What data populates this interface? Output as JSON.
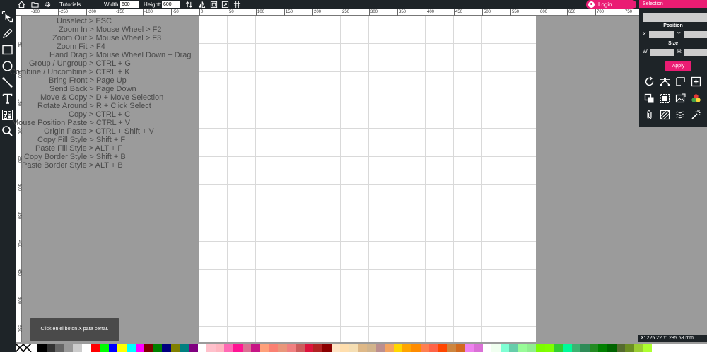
{
  "topbar": {
    "tutorials_label": "Tutorials",
    "width_label": "Width:",
    "width_value": "600",
    "height_label": "Height:",
    "height_value": "600",
    "login_label": "Login",
    "icons": [
      "home-icon",
      "open-folder-icon",
      "settings-icon",
      "swap-vertical-icon",
      "flip-icon",
      "fit-icon",
      "resize-icon",
      "grid-icon"
    ]
  },
  "tools": [
    "select-icon",
    "pencil-icon",
    "rectangle-icon",
    "ellipse-icon",
    "line-icon",
    "text-icon",
    "shapes-icon",
    "zoom-icon"
  ],
  "ruler": {
    "h_ticks": [
      "-300",
      "-250",
      "-200",
      "-150",
      "-100",
      "-50",
      "0",
      "50",
      "100",
      "150",
      "200",
      "250",
      "300",
      "350",
      "400",
      "450",
      "500",
      "550",
      "600",
      "650",
      "700",
      "750"
    ],
    "v_ticks": [
      "50",
      "100",
      "150",
      "200",
      "250",
      "300",
      "350",
      "400",
      "450",
      "500",
      "550"
    ]
  },
  "shortcuts": [
    "Unselect > ESC",
    "Zoom In > Mouse Wheel > F2",
    "Zoom Out > Mouse Wheel > F3",
    "Zoom Fit > F4",
    "Hand Drag > Mouse Wheel Down + Drag",
    "Group / Ungroup > CTRL + G",
    "Combine / Uncombine > CTRL + K",
    "Bring Front > Page Up",
    "Send Back > Page Down",
    "Move & Copy > D + Move Selection",
    "Rotate Around > R + Click Select",
    "Copy > CTRL + C",
    "Mouse Position Paste > CTRL + V",
    "Origin Paste > CTRL + Shift + V",
    "Copy Fill Style > Shift + F",
    "Paste Fill Style > ALT + F",
    "Copy Border Style > Shift + B",
    "Paste Border Style > ALT + B"
  ],
  "toast": "Click en el boton X para cerrar.",
  "panel": {
    "title": "Selection",
    "position_label": "Position",
    "x_label": "X:",
    "y_label": "Y:",
    "size_label": "Size",
    "w_label": "W:",
    "h_label": "H:",
    "apply_label": "Apply",
    "icons": [
      "rotate-icon",
      "bezier-icon",
      "corner-icon",
      "add-box-icon",
      "duplicate-icon",
      "select-all-icon",
      "image-icon",
      "colors-icon",
      "attach-icon",
      "pattern-icon",
      "waves-icon",
      "magic-wand-icon"
    ]
  },
  "coords": "X: 225.22 Y: 285.68 mm",
  "palette": [
    "#000000",
    "#333333",
    "#666666",
    "#999999",
    "#cccccc",
    "#ffffff",
    "#ff0000",
    "#00ff00",
    "#0000ff",
    "#ffff00",
    "#00ffff",
    "#ff00ff",
    "#800000",
    "#008000",
    "#000080",
    "#808000",
    "#008080",
    "#800080",
    "#ffffff",
    "#ffc0cb",
    "#ffb6c1",
    "#ff69b4",
    "#ff1493",
    "#db7093",
    "#c71585",
    "#ffa07a",
    "#fa8072",
    "#e9967a",
    "#f08080",
    "#cd5c5c",
    "#dc143c",
    "#b22222",
    "#8b0000",
    "#ffe4c4",
    "#ffdead",
    "#f5deb3",
    "#deb887",
    "#d2b48c",
    "#bc8f8f",
    "#f4a460",
    "#ffd700",
    "#ffa500",
    "#ff8c00",
    "#ff7f50",
    "#ff6347",
    "#ff4500",
    "#cd853f",
    "#d2691e",
    "#ee82ee",
    "#da70d6",
    "#ffffff",
    "#f0fff0",
    "#7fffd4",
    "#66cdaa",
    "#98fb98",
    "#90ee90",
    "#7cfc00",
    "#7fff00",
    "#32cd32",
    "#00fa9a",
    "#3cb371",
    "#2e8b57",
    "#228b22",
    "#008000",
    "#006400",
    "#556b2f",
    "#6b8e23",
    "#9acd32",
    "#adff2f"
  ]
}
